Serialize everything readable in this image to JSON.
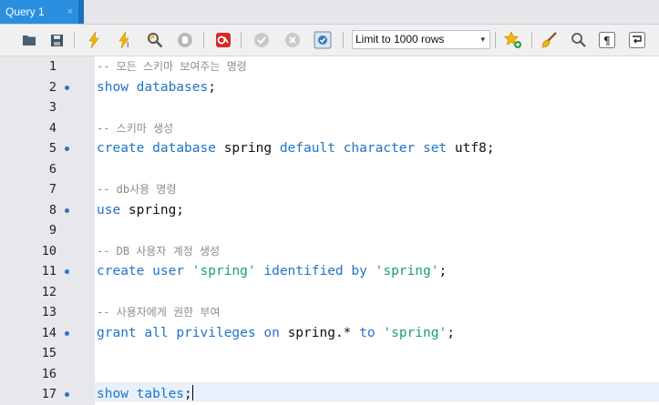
{
  "tab": {
    "title": "Query 1",
    "close": "×"
  },
  "toolbar": {
    "icons": [
      "open-folder-icon",
      "save-icon",
      "execute-icon",
      "execute-current-icon",
      "explain-icon",
      "stop-icon",
      "toggle-output-icon",
      "commit-icon",
      "rollback-icon",
      "autocommit-icon",
      "bookmark-icon",
      "beautify-icon",
      "find-icon",
      "invisible-chars-icon",
      "wrap-icon"
    ],
    "limit_label": "Limit to 1000 rows",
    "limit_arrow": "▾"
  },
  "editor": {
    "lines": [
      {
        "n": "1",
        "dot": false,
        "tokens": [
          {
            "t": "-- 모든 스키마 보여주는 명령",
            "c": "cm"
          }
        ]
      },
      {
        "n": "2",
        "dot": true,
        "tokens": [
          {
            "t": "show",
            "c": "kw"
          },
          {
            "t": " ",
            "c": "pl"
          },
          {
            "t": "databases",
            "c": "kw"
          },
          {
            "t": ";",
            "c": "pl"
          }
        ]
      },
      {
        "n": "3",
        "dot": false,
        "tokens": []
      },
      {
        "n": "4",
        "dot": false,
        "tokens": [
          {
            "t": "-- 스키마 생성",
            "c": "cm"
          }
        ]
      },
      {
        "n": "5",
        "dot": true,
        "tokens": [
          {
            "t": "create",
            "c": "kw"
          },
          {
            "t": " ",
            "c": "pl"
          },
          {
            "t": "database",
            "c": "kw"
          },
          {
            "t": " spring ",
            "c": "pl"
          },
          {
            "t": "default",
            "c": "kw"
          },
          {
            "t": " ",
            "c": "pl"
          },
          {
            "t": "character",
            "c": "kw"
          },
          {
            "t": " ",
            "c": "pl"
          },
          {
            "t": "set",
            "c": "kw"
          },
          {
            "t": " utf8;",
            "c": "pl"
          }
        ]
      },
      {
        "n": "6",
        "dot": false,
        "tokens": []
      },
      {
        "n": "7",
        "dot": false,
        "tokens": [
          {
            "t": "-- db사용 명령",
            "c": "cm"
          }
        ]
      },
      {
        "n": "8",
        "dot": true,
        "tokens": [
          {
            "t": "use",
            "c": "kw"
          },
          {
            "t": " spring;",
            "c": "pl"
          }
        ]
      },
      {
        "n": "9",
        "dot": false,
        "tokens": []
      },
      {
        "n": "10",
        "dot": false,
        "tokens": [
          {
            "t": "-- DB 사용자 계정 생성",
            "c": "cm"
          }
        ]
      },
      {
        "n": "11",
        "dot": true,
        "tokens": [
          {
            "t": "create",
            "c": "kw"
          },
          {
            "t": " ",
            "c": "pl"
          },
          {
            "t": "user",
            "c": "kw"
          },
          {
            "t": " ",
            "c": "pl"
          },
          {
            "t": "'spring'",
            "c": "str"
          },
          {
            "t": " ",
            "c": "pl"
          },
          {
            "t": "identified",
            "c": "kw"
          },
          {
            "t": " ",
            "c": "pl"
          },
          {
            "t": "by",
            "c": "kw"
          },
          {
            "t": " ",
            "c": "pl"
          },
          {
            "t": "'spring'",
            "c": "str"
          },
          {
            "t": ";",
            "c": "pl"
          }
        ]
      },
      {
        "n": "12",
        "dot": false,
        "tokens": []
      },
      {
        "n": "13",
        "dot": false,
        "tokens": [
          {
            "t": "-- 사용자에게 권한 부여",
            "c": "cm"
          }
        ]
      },
      {
        "n": "14",
        "dot": true,
        "tokens": [
          {
            "t": "grant",
            "c": "kw"
          },
          {
            "t": " ",
            "c": "pl"
          },
          {
            "t": "all",
            "c": "kw"
          },
          {
            "t": " ",
            "c": "pl"
          },
          {
            "t": "privileges",
            "c": "kw"
          },
          {
            "t": " ",
            "c": "pl"
          },
          {
            "t": "on",
            "c": "kw"
          },
          {
            "t": " spring.* ",
            "c": "pl"
          },
          {
            "t": "to",
            "c": "kw"
          },
          {
            "t": " ",
            "c": "pl"
          },
          {
            "t": "'spring'",
            "c": "str"
          },
          {
            "t": ";",
            "c": "pl"
          }
        ]
      },
      {
        "n": "15",
        "dot": false,
        "tokens": []
      },
      {
        "n": "16",
        "dot": false,
        "tokens": []
      },
      {
        "n": "17",
        "dot": true,
        "tokens": [
          {
            "t": "show",
            "c": "kw"
          },
          {
            "t": " ",
            "c": "pl"
          },
          {
            "t": "tables",
            "c": "kw"
          },
          {
            "t": ";",
            "c": "pl"
          }
        ],
        "caret": true
      }
    ]
  }
}
